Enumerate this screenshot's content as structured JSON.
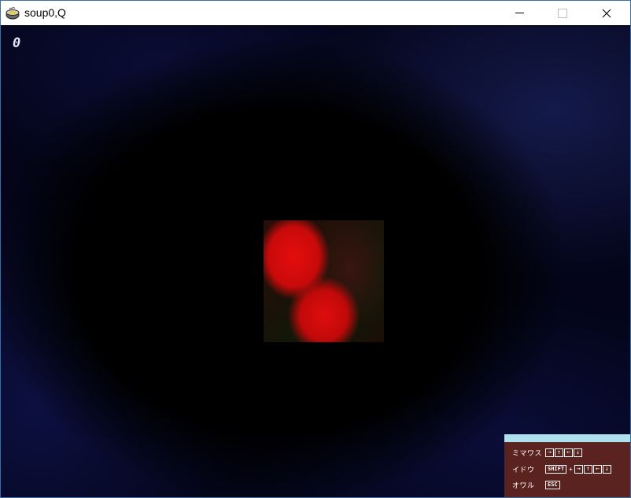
{
  "window": {
    "title": "soup0,Q",
    "controls": {
      "minimize": "",
      "maximize": "",
      "close": "✕"
    }
  },
  "hud": {
    "counter": "0"
  },
  "help": {
    "rows": [
      {
        "label": "ミマワス",
        "keys": [
          "→",
          "↑",
          "←",
          "↓"
        ]
      },
      {
        "label": "イドウ",
        "modifier": "SHIFT",
        "plus": "+",
        "keys": [
          "→",
          "↑",
          "←",
          "↓"
        ]
      },
      {
        "label": "オワル",
        "keys": [
          "ESC"
        ]
      }
    ]
  },
  "colors": {
    "panel": "#5a231f",
    "panel_accent": "#aee0ee",
    "sprite_red": "#e00d0d"
  }
}
